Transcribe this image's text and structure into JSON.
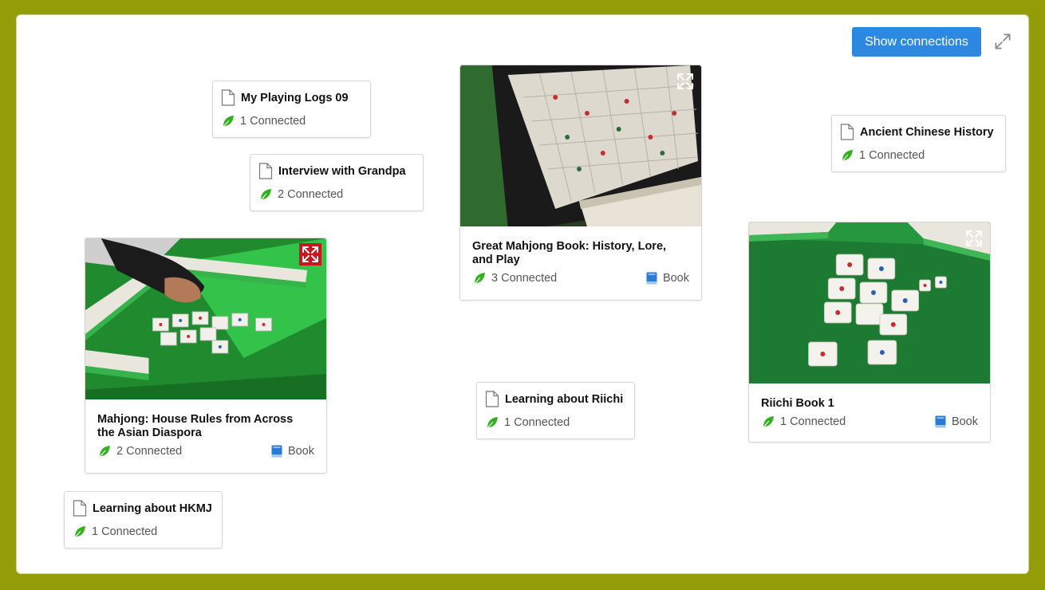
{
  "toolbar": {
    "show_connections_label": "Show connections",
    "expand_icon": "expand-icon"
  },
  "colors": {
    "background": "#939d08",
    "button": "#2c88e0",
    "leaf": "#2fb31a",
    "book": "#2a7bd6",
    "active_expand": "#c8171e"
  },
  "notes": [
    {
      "title": "My Playing Logs 09",
      "connected": "1 Connected"
    },
    {
      "title": "Interview with Grandpa",
      "connected": "2 Connected"
    },
    {
      "title": "Ancient Chinese History",
      "connected": "1 Connected"
    },
    {
      "title": "Learning about Riichi",
      "connected": "1 Connected"
    },
    {
      "title": "Learning about HKMJ",
      "connected": "1 Connected"
    }
  ],
  "books": [
    {
      "title": "Great Mahjong Book: History, Lore, and Play",
      "connected": "3 Connected",
      "type": "Book"
    },
    {
      "title": "Mahjong: House Rules from Across the Asian Diaspora",
      "connected": "2 Connected",
      "type": "Book"
    },
    {
      "title": "Riichi Book 1",
      "connected": "1 Connected",
      "type": "Book"
    }
  ]
}
